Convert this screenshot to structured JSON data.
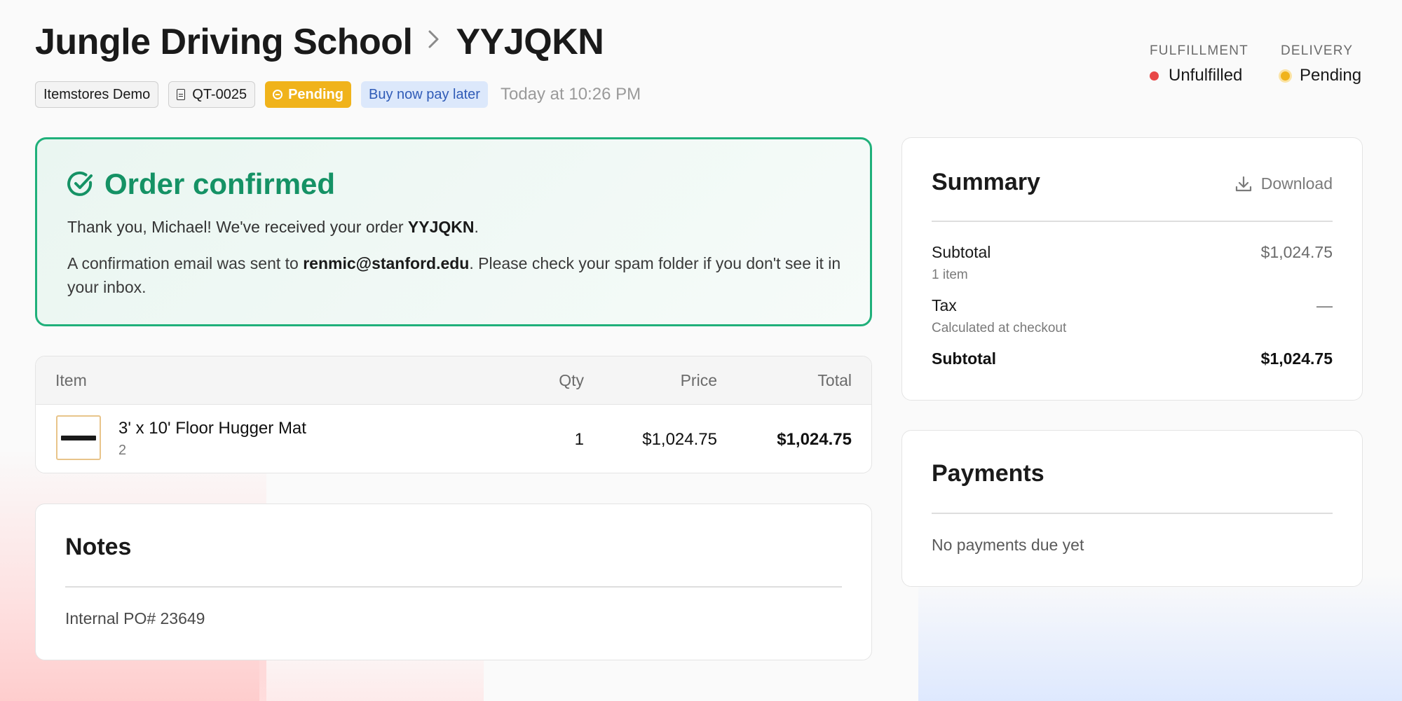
{
  "header": {
    "store_name": "Jungle Driving School",
    "order_id": "YYJQKN",
    "tags": {
      "store": "Itemstores Demo",
      "quote": "QT-0025",
      "status": "Pending",
      "payment_method": "Buy now pay later",
      "timestamp": "Today at 10:26 PM"
    },
    "fulfillment": {
      "label": "FULFILLMENT",
      "value": "Unfulfilled",
      "color": "#e84848"
    },
    "delivery": {
      "label": "DELIVERY",
      "value": "Pending",
      "color": "#f0b31b"
    }
  },
  "confirmation": {
    "title": "Order confirmed",
    "thanks_prefix": "Thank you, Michael! We've received your order ",
    "order_id": "YYJQKN",
    "thanks_suffix": ".",
    "email_prefix": "A confirmation email was sent to ",
    "email": "renmic@stanford.edu",
    "email_suffix": ". Please check your spam folder if you don't see it in your inbox.",
    "accent": "#1fb07a"
  },
  "items_table": {
    "columns": {
      "item": "Item",
      "qty": "Qty",
      "price": "Price",
      "total": "Total"
    },
    "rows": [
      {
        "name": "3' x 10' Floor Hugger Mat",
        "sub": "2",
        "qty": "1",
        "price": "$1,024.75",
        "total": "$1,024.75"
      }
    ]
  },
  "notes": {
    "title": "Notes",
    "text": "Internal PO# 23649"
  },
  "summary": {
    "title": "Summary",
    "download_label": "Download",
    "subtotal_label": "Subtotal",
    "subtotal_sub": "1 item",
    "subtotal_value": "$1,024.75",
    "tax_label": "Tax",
    "tax_sub": "Calculated at checkout",
    "tax_value": "—",
    "total_label": "Subtotal",
    "total_value": "$1,024.75"
  },
  "payments": {
    "title": "Payments",
    "empty_text": "No payments due yet"
  }
}
